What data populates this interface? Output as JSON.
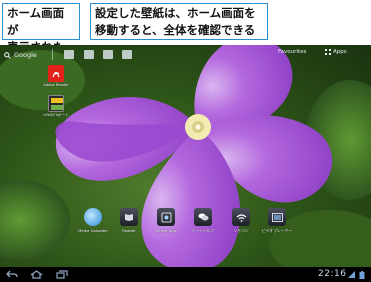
{
  "callouts": {
    "left": [
      "ホーム画面が",
      "表示された"
    ],
    "right": [
      "設定した壁紙は、ホーム画面を",
      "移動すると、全体を確認できる"
    ]
  },
  "top_bar": {
    "search_label": "Google",
    "icons": [
      "search-icon",
      "voice-icon",
      "apps-icon",
      "mail-icon",
      "calendar-icon",
      "settings-icon"
    ],
    "right_labels": [
      "Favourites",
      "Apps"
    ]
  },
  "desktop_apps": [
    {
      "label": "Adobe Reader",
      "icon": "pdf-icon",
      "color": "#e3221c"
    },
    {
      "label": "LifeのFXポート",
      "icon": "life-icon",
      "color": "#2b2b2b"
    }
  ],
  "dock_apps": [
    {
      "label": "Media Uploader",
      "icon": "globe-icon"
    },
    {
      "label": "Reader",
      "icon": "book-icon"
    },
    {
      "label": "Select app",
      "icon": "photo-icon"
    },
    {
      "label": "ソーシャルフ",
      "icon": "chat-icon"
    },
    {
      "label": "リモコン",
      "icon": "wifi-icon"
    },
    {
      "label": "ビデオプレーヤー",
      "icon": "video-icon"
    }
  ],
  "system_bar": {
    "clock": "22:16",
    "nav": [
      "back-icon",
      "home-icon",
      "recent-apps-icon"
    ],
    "status": [
      "wifi-signal-icon",
      "battery-icon"
    ]
  },
  "colors": {
    "callout_border": "#2a8fd6",
    "petal": "#a34fd6",
    "flower_center": "#f3ecb0",
    "leaf": "#3f6e22",
    "system_bar": "#000000"
  }
}
